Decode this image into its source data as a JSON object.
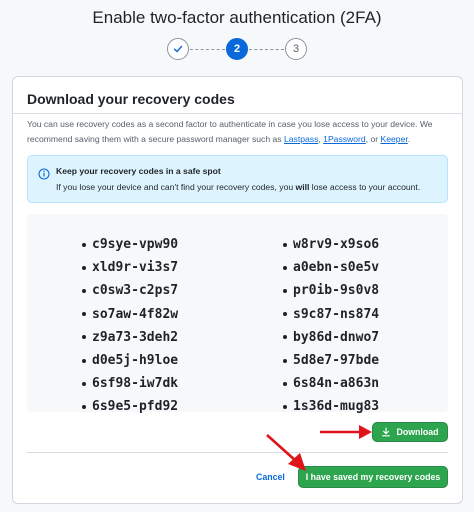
{
  "page": {
    "title": "Enable two-factor authentication (2FA)"
  },
  "stepper": {
    "steps": [
      {
        "label": "",
        "state": "complete",
        "icon": "check-icon"
      },
      {
        "label": "2",
        "state": "active"
      },
      {
        "label": "3",
        "state": "pending"
      }
    ]
  },
  "card": {
    "heading": "Download your recovery codes",
    "description": {
      "text_1": "You can use recovery codes as a second factor to authenticate in case you lose access to your device. We recommend saving them with a secure password manager such as ",
      "link_lastpass": "Lastpass",
      "sep_1": ", ",
      "link_1password": "1Password",
      "sep_2": ", or ",
      "link_keeper": "Keeper",
      "text_end": "."
    },
    "notice": {
      "icon": "info-icon",
      "title": "Keep your recovery codes in a safe spot",
      "body_1": "If you lose your device and can't find your recovery codes, you ",
      "body_bold": "will",
      "body_2": " lose access to your account."
    },
    "codes": {
      "left": [
        "c9sye-vpw90",
        "xld9r-vi3s7",
        "c0sw3-c2ps7",
        "so7aw-4f82w",
        "z9a73-3deh2",
        "d0e5j-h9loe",
        "6sf98-iw7dk",
        "6s9e5-pfd92"
      ],
      "right": [
        "w8rv9-x9so6",
        "a0ebn-s0e5v",
        "pr0ib-9s0v8",
        "s9c87-ns874",
        "by86d-dnwo7",
        "5d8e7-97bde",
        "6s84n-a863n",
        "1s36d-mug83"
      ]
    },
    "actions": {
      "download_label": "Download",
      "download_icon": "download-icon",
      "cancel_label": "Cancel",
      "saved_label": "I have saved my recovery codes"
    }
  },
  "colors": {
    "accent_blue": "#0969da",
    "button_green": "#2da44e",
    "notice_bg": "#ddf4ff",
    "annotation_red": "#e0121a"
  }
}
